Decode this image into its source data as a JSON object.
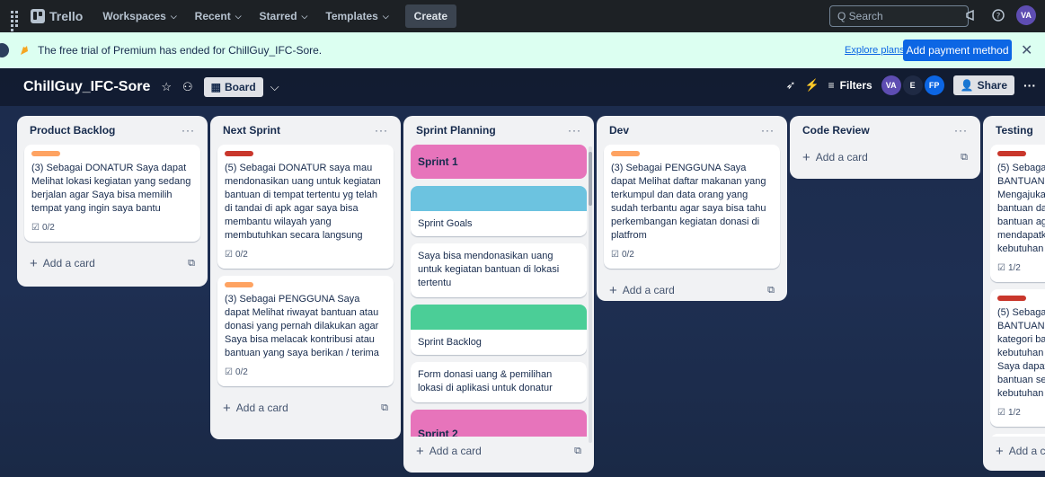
{
  "topnav": {
    "logo": "Trello",
    "workspaces": "Workspaces",
    "recent": "Recent",
    "starred": "Starred",
    "templates": "Templates",
    "create": "Create",
    "search_placeholder": "Q Search",
    "avatar": "VA"
  },
  "banner": {
    "text": "The free trial of Premium has ended for ChillGuy_IFC-Sore.",
    "explore": "Explore plans",
    "pay": "Add payment method",
    "close": "✕"
  },
  "board": {
    "title": "ChillGuy_IFC-Sore",
    "view": "Board",
    "filters": "Filters",
    "members": [
      {
        "initials": "VA",
        "color": "#5e4db2"
      },
      {
        "initials": "E",
        "color": "#1f2a44"
      },
      {
        "initials": "FP",
        "color": "#0c66e4"
      }
    ],
    "share": "Share"
  },
  "lists": {
    "backlog": {
      "title": "Product Backlog",
      "menu": "···",
      "cards": [
        {
          "label_color": "#fea362",
          "text": "(3) Sebagai DONATUR Saya dapat Melihat lokasi kegiatan yang sedang berjalan agar Saya bisa memilih tempat yang ingin saya bantu",
          "checklist": "0/2"
        }
      ],
      "add": "Add a card"
    },
    "next": {
      "title": "Next Sprint",
      "menu": "···",
      "cards": [
        {
          "label_color": "#c9372c",
          "text": "(5) Sebagai DONATUR saya mau mendonasikan uang untuk kegiatan bantuan di tempat tertentu yg telah di tandai di apk agar saya bisa membantu wilayah yang membutuhkan secara langsung",
          "checklist": "0/2"
        },
        {
          "label_color": "#fea362",
          "text": "(3) Sebagai PENGGUNA Saya dapat Melihat riwayat bantuan atau donasi yang pernah dilakukan agar Saya bisa melacak kontribusi atau bantuan yang saya berikan / terima",
          "checklist": "0/2"
        }
      ],
      "add": "Add a card"
    },
    "planning": {
      "title": "Sprint Planning",
      "menu": "···",
      "sprint1": "Sprint 1",
      "sprint1_color": "#e774bb",
      "goals_cover": "#6cc3e0",
      "goals": "Sprint Goals",
      "goal_text": "Saya bisa mendonasikan uang untuk kegiatan bantuan di lokasi tertentu",
      "backlog_cover": "#4bce97",
      "backlog": "Sprint Backlog",
      "backlog_text": "Form donasi uang & pemilihan lokasi di aplikasi untuk donatur",
      "sprint2": "Sprint 2",
      "add": "Add a card"
    },
    "dev": {
      "title": "Dev",
      "menu": "···",
      "cards": [
        {
          "label_color": "#fea362",
          "text": "(3) Sebagai PENGGUNA Saya dapat Melihat daftar makanan yang terkumpul dan data orang yang sudah terbantu agar saya bisa tahu perkembangan kegiatan donasi di platfrom",
          "checklist": "0/2"
        }
      ],
      "add": "Add a card"
    },
    "review": {
      "title": "Code Review",
      "menu": "···",
      "add": "Add a card"
    },
    "testing": {
      "title": "Testing",
      "cards": [
        {
          "label_color": "#c9372c",
          "lines": [
            "(5) Sebaga",
            "BANTUAN",
            "Mengajuka",
            "bantuan da",
            "bantuan ag",
            "mendapatk",
            "kebutuhan"
          ],
          "checklist": "1/2"
        },
        {
          "label_color": "#c9372c",
          "lines": [
            "(5) Sebaga",
            "BANTUAN",
            "kategori ba",
            "kebutuhan",
            "Saya dapat",
            "bantuan se",
            "kebutuhan"
          ],
          "checklist": "1/2"
        }
      ],
      "add": "Add a c"
    }
  }
}
